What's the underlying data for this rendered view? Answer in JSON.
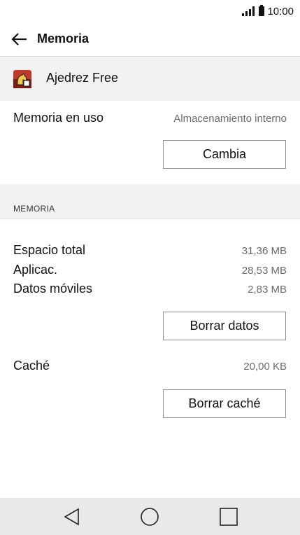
{
  "status_bar": {
    "time": "10:00",
    "icons": [
      "signal-icon",
      "battery-icon"
    ]
  },
  "app_bar": {
    "back_icon": "arrow-left-icon",
    "title": "Memoria"
  },
  "app": {
    "icon": "chess-app-icon",
    "name": "Ajedrez Free"
  },
  "storage": {
    "label": "Memoria en uso",
    "value": "Almacenamiento interno",
    "change_button": "Cambia"
  },
  "memory_section": {
    "header": "MEMORIA",
    "rows": [
      {
        "label": "Espacio total",
        "value": "31,36 MB"
      },
      {
        "label": "Aplicac.",
        "value": "28,53 MB"
      },
      {
        "label": "Datos móviles",
        "value": "2,83 MB"
      }
    ],
    "clear_data_button": "Borrar datos"
  },
  "cache": {
    "label": "Caché",
    "value": "20,00 KB",
    "clear_cache_button": "Borrar caché"
  },
  "nav_bar": {
    "icons": [
      "back-triangle-icon",
      "home-circle-icon",
      "recents-square-icon"
    ]
  },
  "colors": {
    "section_background": "#f2f2f3",
    "nav_background": "#e9e9ea",
    "button_border": "#8f8f8f"
  }
}
